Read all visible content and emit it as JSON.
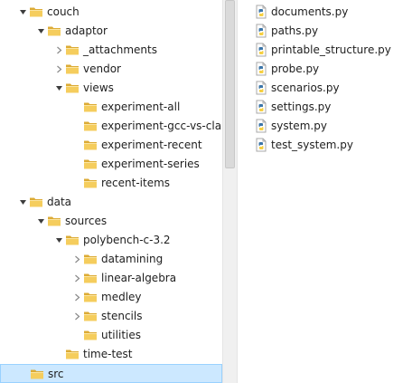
{
  "tree": [
    {
      "label": "couch",
      "toggle": "expanded"
    },
    {
      "label": "adaptor",
      "toggle": "expanded"
    },
    {
      "label": "_attachments",
      "toggle": "collapsed"
    },
    {
      "label": "vendor",
      "toggle": "collapsed"
    },
    {
      "label": "views",
      "toggle": "expanded"
    },
    {
      "label": "experiment-all",
      "toggle": "none"
    },
    {
      "label": "experiment-gcc-vs-clang",
      "toggle": "none"
    },
    {
      "label": "experiment-recent",
      "toggle": "none"
    },
    {
      "label": "experiment-series",
      "toggle": "none"
    },
    {
      "label": "recent-items",
      "toggle": "none"
    },
    {
      "label": "data",
      "toggle": "expanded"
    },
    {
      "label": "sources",
      "toggle": "expanded"
    },
    {
      "label": "polybench-c-3.2",
      "toggle": "expanded"
    },
    {
      "label": "datamining",
      "toggle": "collapsed"
    },
    {
      "label": "linear-algebra",
      "toggle": "collapsed"
    },
    {
      "label": "medley",
      "toggle": "collapsed"
    },
    {
      "label": "stencils",
      "toggle": "collapsed"
    },
    {
      "label": "utilities",
      "toggle": "none"
    },
    {
      "label": "time-test",
      "toggle": "none"
    },
    {
      "label": "src",
      "toggle": "none",
      "selected": true
    }
  ],
  "files": [
    "documents.py",
    "paths.py",
    "printable_structure.py",
    "probe.py",
    "scenarios.py",
    "settings.py",
    "system.py",
    "test_system.py"
  ],
  "icons": {
    "folder": "folder-icon",
    "python_file": "python-file-icon",
    "expanded": "chevron-down-icon",
    "collapsed": "chevron-right-icon"
  },
  "colors": {
    "folder_body": "#f5cd5d",
    "folder_tab": "#dcab35",
    "selection_bg": "#cce8ff",
    "selection_border": "#99d1ff",
    "python_blue": "#3b75a8",
    "python_yellow": "#f6cf42"
  }
}
